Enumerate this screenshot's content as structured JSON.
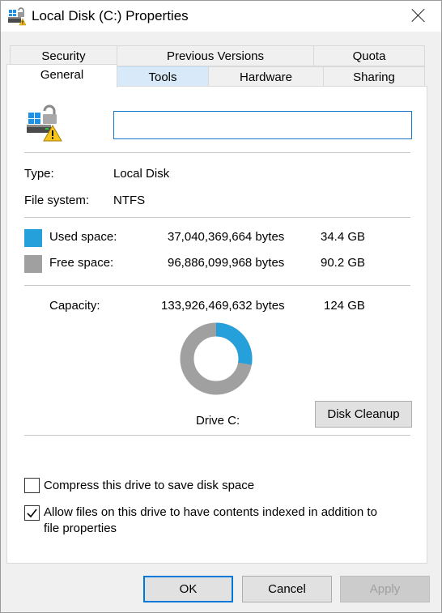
{
  "window": {
    "title": "Local Disk (C:) Properties"
  },
  "tabs": {
    "row1": [
      {
        "label": "Security"
      },
      {
        "label": "Previous Versions"
      },
      {
        "label": "Quota"
      }
    ],
    "row2": [
      {
        "label": "General",
        "state": "active"
      },
      {
        "label": "Tools",
        "state": "hovered"
      },
      {
        "label": "Hardware"
      },
      {
        "label": "Sharing"
      }
    ]
  },
  "general": {
    "drive_icon": "drive-warning-icon",
    "name_value": "",
    "type_label": "Type:",
    "type_value": "Local Disk",
    "fs_label": "File system:",
    "fs_value": "NTFS",
    "used": {
      "label": "Used space:",
      "bytes": "37,040,369,664 bytes",
      "size": "34.4 GB",
      "color": "#26a0da"
    },
    "free": {
      "label": "Free space:",
      "bytes": "96,886,099,968 bytes",
      "size": "90.2 GB",
      "color": "#a0a0a0"
    },
    "capacity": {
      "label": "Capacity:",
      "bytes": "133,926,469,632 bytes",
      "size": "124 GB"
    },
    "used_fraction": 0.2766,
    "drive_label": "Drive C:",
    "cleanup_label": "Disk Cleanup",
    "compress_label": "Compress this drive to save disk space",
    "compress_checked": false,
    "index_label_line1": "Allow files on this drive to have contents indexed in addition to",
    "index_label_line2": "file properties",
    "index_checked": true
  },
  "buttons": {
    "ok": "OK",
    "cancel": "Cancel",
    "apply": "Apply"
  }
}
